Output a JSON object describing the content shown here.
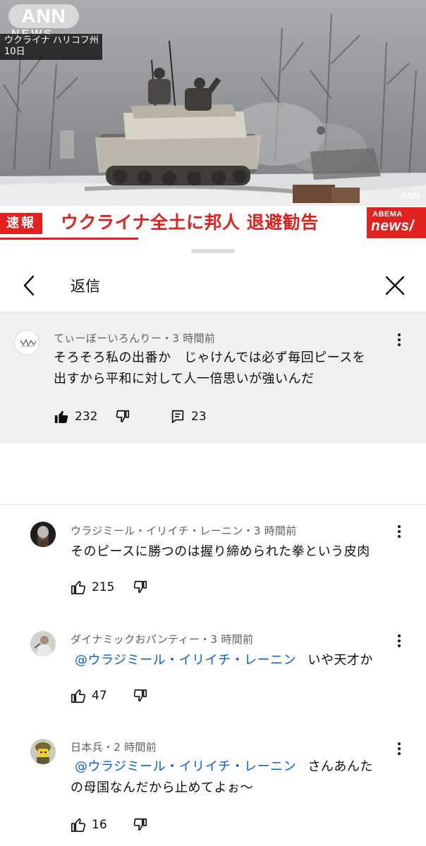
{
  "video": {
    "channel_logo": "ANN",
    "channel_sub": "NEWS",
    "location_line1": "ウクライナ ハリコフ州",
    "location_line2": "10日",
    "corner_logo": "ANN",
    "breaking_label": "速報",
    "headline": "ウクライナ全土に邦人 退避勧告",
    "abema_top": "ABEMA",
    "abema_bottom": "news/",
    "colors": {
      "ticker_red": "#e0211d"
    }
  },
  "sheet": {
    "title": "返信",
    "back_icon": "chevron-left-icon",
    "close_icon": "close-icon"
  },
  "parent_comment": {
    "author": "てぃーぼーいろんりー",
    "time": "3 時間前",
    "text_line1": "そろそろ私の出番か　じゃけんでは必ず毎回ピースを",
    "text_line2": "出すから平和に対して人一倍思いが強いんだ",
    "likes": "232",
    "replies": "23",
    "liked": true
  },
  "replies": [
    {
      "author": "ウラジミール・イリイチ・レーニン",
      "time": "3 時間前",
      "text_line1": "そのピースに勝つのは握り締められた拳という皮肉",
      "likes": "215"
    },
    {
      "author": "ダイナミックおパンティー",
      "time": "3 時間前",
      "mention": "@ウラジミール・イリイチ・レーニン",
      "text_line1_after": "いや天才か",
      "likes": "47"
    },
    {
      "author": "日本兵",
      "time": "2 時間前",
      "mention": "@ウラジミール・イリイチ・レーニン",
      "text_line1_after": "さんあんた",
      "text_line2": "の母国なんだから止めてよぉ〜",
      "likes": "16"
    }
  ],
  "separator": "・"
}
